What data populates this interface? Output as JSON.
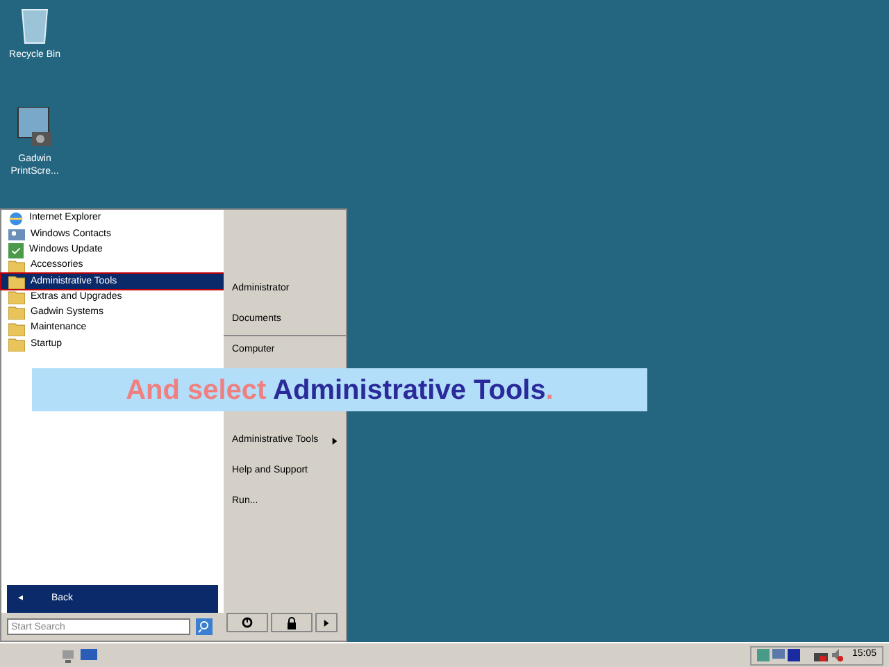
{
  "desktop_icons": [
    {
      "label": "Recycle Bin",
      "kind": "bin"
    },
    {
      "label": "Gadwin PrintScre...",
      "kind": "app"
    }
  ],
  "start_menu": {
    "programs": [
      {
        "label": "Internet Explorer",
        "kind": "ie",
        "selected": false
      },
      {
        "label": "Windows Contacts",
        "kind": "contacts",
        "selected": false
      },
      {
        "label": "Windows Update",
        "kind": "update",
        "selected": false
      },
      {
        "label": "Accessories",
        "kind": "folder",
        "selected": false
      },
      {
        "label": "Administrative Tools",
        "kind": "folder",
        "selected": true
      },
      {
        "label": "Extras and Upgrades",
        "kind": "folder",
        "selected": false
      },
      {
        "label": "Gadwin Systems",
        "kind": "folder",
        "selected": false
      },
      {
        "label": "Maintenance",
        "kind": "folder",
        "selected": false
      },
      {
        "label": "Startup",
        "kind": "folder",
        "selected": false
      }
    ],
    "back": {
      "arrow": "◂",
      "label": "Back"
    },
    "search": {
      "placeholder": "Start Search"
    },
    "places": [
      {
        "label": "Administrator",
        "submenu": false,
        "separator": false
      },
      {
        "label": "Documents",
        "submenu": false,
        "separator": false
      },
      {
        "label": "Computer",
        "submenu": false,
        "separator": true
      },
      {
        "label": "Administrative Tools",
        "submenu": true,
        "separator": false,
        "gap_before": true
      },
      {
        "label": "Help and Support",
        "submenu": false,
        "separator": false
      },
      {
        "label": "Run...",
        "submenu": false,
        "separator": false
      }
    ]
  },
  "caption": [
    {
      "text": "And select",
      "kind": "plain"
    },
    {
      "text": "Administrative Tools",
      "kind": "highlight"
    },
    {
      "text": ".",
      "kind": "plain"
    }
  ],
  "taskbar": {
    "clock": "15:05"
  }
}
